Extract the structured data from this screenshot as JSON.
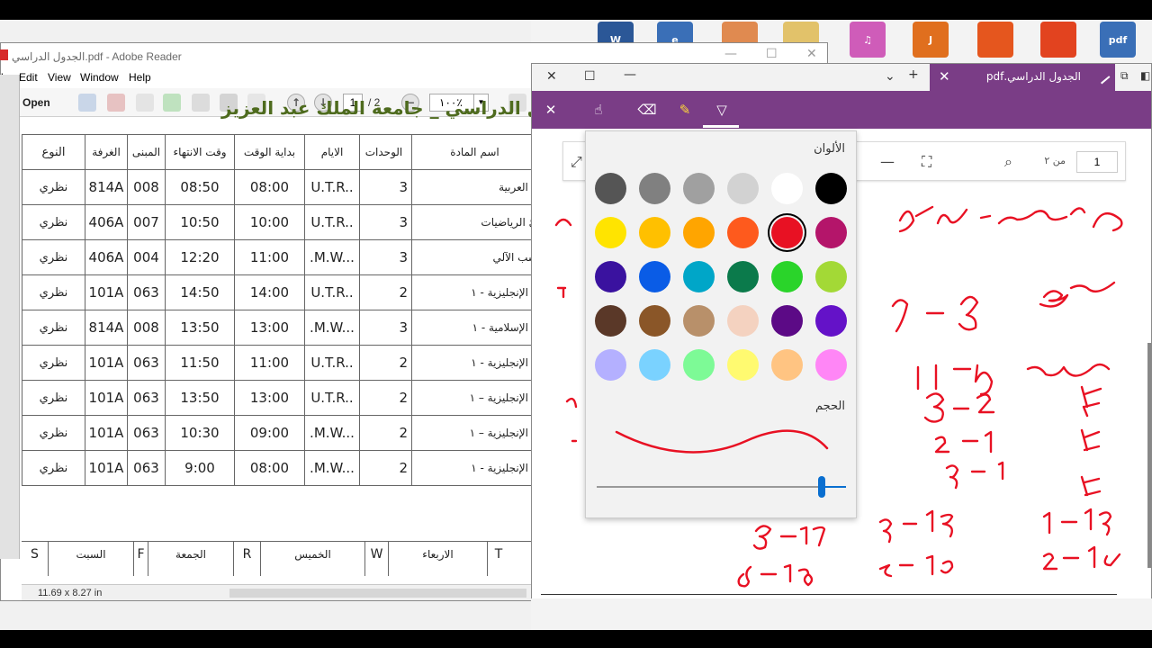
{
  "desktop": {
    "icons": [
      {
        "name": "word-doc-icon",
        "color": "#2b5797",
        "glyph": "W"
      },
      {
        "name": "pdf-file-icon",
        "color": "#3a6fb7",
        "glyph": "e"
      },
      {
        "name": "image-file-icon",
        "color": "#e08a50",
        "glyph": ""
      },
      {
        "name": "folder-icon",
        "color": "#e2c26a",
        "glyph": ""
      },
      {
        "name": "itunes-icon",
        "color": "#cf5cb9",
        "glyph": "♫"
      },
      {
        "name": "java-icon",
        "color": "#e06f1e",
        "glyph": "J"
      },
      {
        "name": "firefox-icon",
        "color": "#e5561e",
        "glyph": ""
      },
      {
        "name": "office-icon",
        "color": "#e2431f",
        "glyph": ""
      },
      {
        "name": "edge-pdf-icon",
        "color": "#3a6fb7",
        "glyph": "pdf"
      }
    ]
  },
  "reader": {
    "title": "الجدول الدراسي.pdf - Adobe Reader",
    "menu": [
      "le",
      "Edit",
      "View",
      "Window",
      "Help"
    ],
    "open_label": "Open",
    "page_current": "1",
    "page_total": "/ 2",
    "zoom": "١٠٠٪",
    "doc_title": "الجدول الدراسي _ جامعة الملك عبد العزيز",
    "headers": [
      "النوع",
      "الغرفة",
      "المبنى",
      "وقت الانتهاء",
      "بداية الوقت",
      "الايام",
      "الوحدات",
      "اسم المادة"
    ],
    "rows": [
      {
        "type": "نظري",
        "room": "814A",
        "bld": "008",
        "end": "08:50",
        "start": "08:00",
        "days": "U.T.R..",
        "units": "3",
        "name": "ة العربية"
      },
      {
        "type": "نظري",
        "room": "406A",
        "bld": "007",
        "end": "10:50",
        "start": "10:00",
        "days": "U.T.R..",
        "units": "3",
        "name": "ئ الرياضيات"
      },
      {
        "type": "نظري",
        "room": "406A",
        "bld": "004",
        "end": "12:20",
        "start": "11:00",
        "days": ".M.W...",
        "units": "3",
        "name": "سب الآلي"
      },
      {
        "type": "نظري",
        "room": "101A",
        "bld": "063",
        "end": "14:50",
        "start": "14:00",
        "days": "U.T.R..",
        "units": "2",
        "name": "ة الإنجليزية - ١"
      },
      {
        "type": "نظري",
        "room": "814A",
        "bld": "008",
        "end": "13:50",
        "start": "13:00",
        "days": ".M.W...",
        "units": "3",
        "name": "ة الإسلامية - ١"
      },
      {
        "type": "نظري",
        "room": "101A",
        "bld": "063",
        "end": "11:50",
        "start": "11:00",
        "days": "U.T.R..",
        "units": "2",
        "name": "ة الإنجليزية - ١"
      },
      {
        "type": "نظري",
        "room": "101A",
        "bld": "063",
        "end": "13:50",
        "start": "13:00",
        "days": "U.T.R..",
        "units": "2",
        "name": "ة الإنجليزية – ١"
      },
      {
        "type": "نظري",
        "room": "101A",
        "bld": "063",
        "end": "10:30",
        "start": "09:00",
        "days": ".M.W...",
        "units": "2",
        "name": "ة الإنجليزية – ١"
      },
      {
        "type": "نظري",
        "room": "101A",
        "bld": "063",
        "end": "9:00",
        "start": "08:00",
        "days": ".M.W...",
        "units": "2",
        "name": "ة الإنجليزية - ١"
      }
    ],
    "days_legend": [
      {
        "code": "S",
        "name": "السبت"
      },
      {
        "code": "F",
        "name": "الجمعة"
      },
      {
        "code": "R",
        "name": "الخميس"
      },
      {
        "code": "W",
        "name": "الاربعاء"
      },
      {
        "code": "T",
        "name": ""
      }
    ],
    "status": "11.69 x 8.27 in"
  },
  "edge": {
    "tab_title": "الجدول الدراسي.pdf",
    "page_current": "1",
    "page_of": "من ٢",
    "colors_label": "الألوان",
    "size_label": "الحجم",
    "selected_color": "#e81123",
    "pen_size": 0.9,
    "palette": [
      [
        "#000000",
        "#ffffff",
        "#d2d2d2",
        "#a0a0a0",
        "#808080",
        "#555555"
      ],
      [
        "#b4156a",
        "#e81123",
        "#fe5a1d",
        "#ffa500",
        "#ffc000",
        "#ffe400"
      ],
      [
        "#a3d936",
        "#2ad42a",
        "#0b7a4b",
        "#00a6c8",
        "#0a5ce6",
        "#3a129f"
      ],
      [
        "#6412c8",
        "#5c0a86",
        "#f4d2c0",
        "#b8906a",
        "#8a5628",
        "#5a3828"
      ],
      [
        "#ff86f6",
        "#ffc482",
        "#fffa70",
        "#7dfa96",
        "#7ad2ff",
        "#b4b0ff"
      ]
    ]
  }
}
